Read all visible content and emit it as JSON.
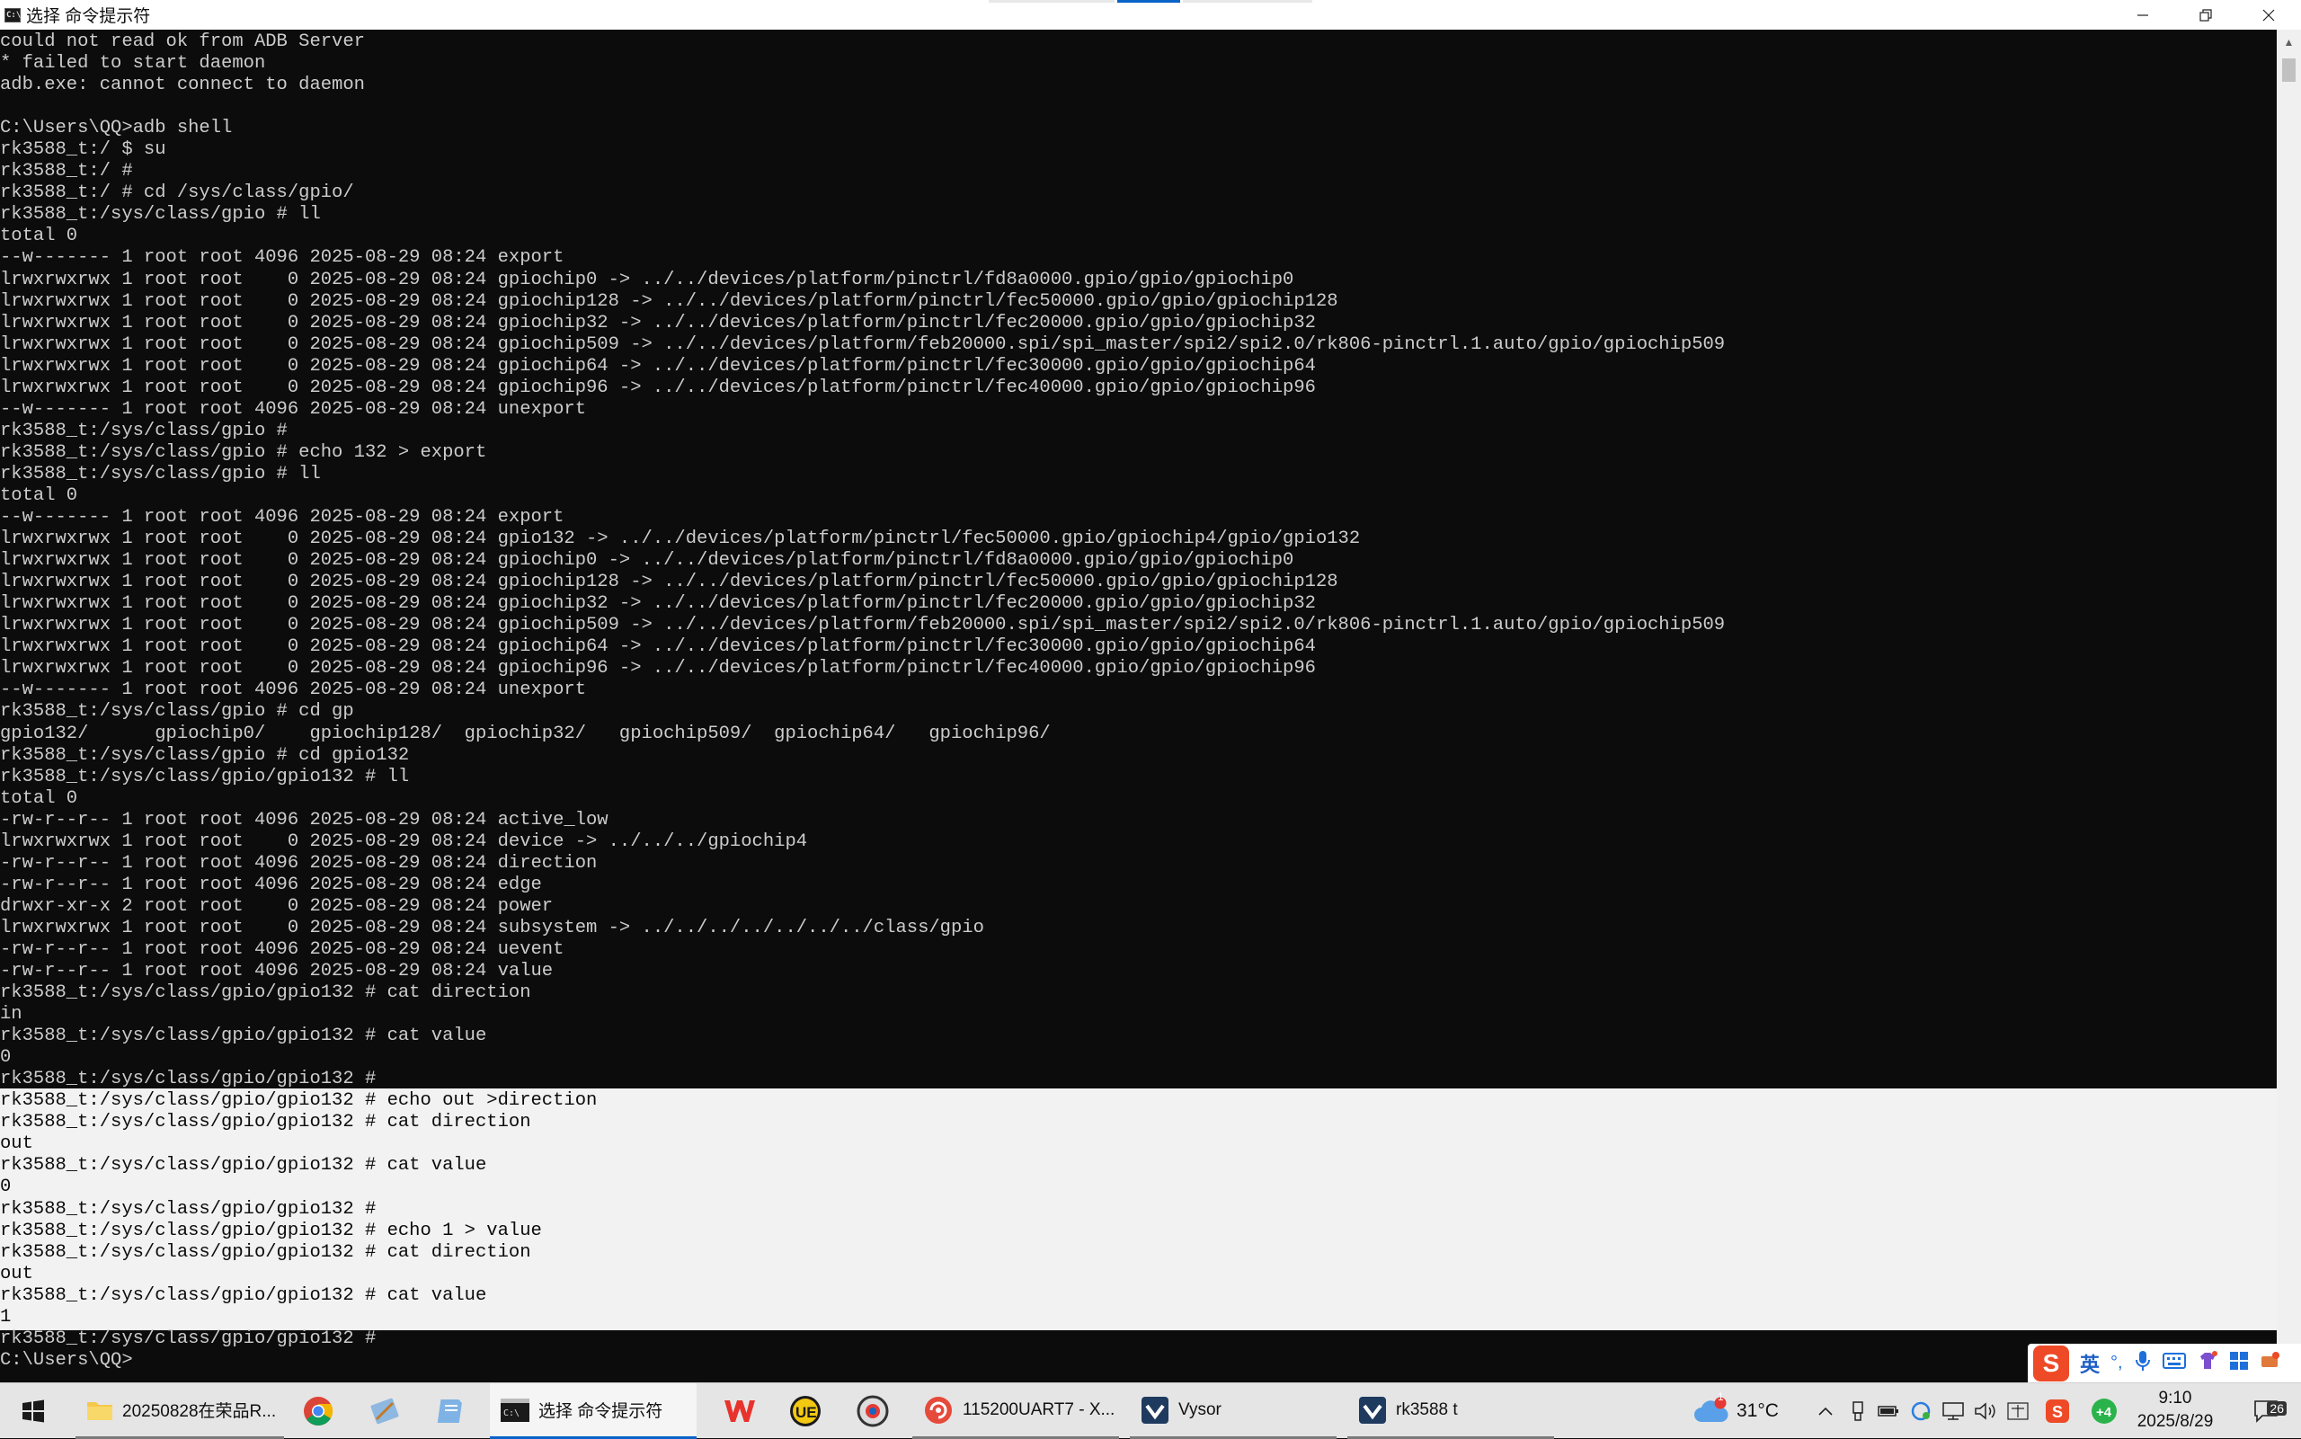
{
  "window": {
    "title": "选择 命令提示符",
    "icon_text": "C:\\"
  },
  "terminal": {
    "lines": [
      "could not read ok from ADB Server",
      "* failed to start daemon",
      "adb.exe: cannot connect to daemon",
      "",
      "C:\\Users\\QQ>adb shell",
      "rk3588_t:/ $ su",
      "rk3588_t:/ #",
      "rk3588_t:/ # cd /sys/class/gpio/",
      "rk3588_t:/sys/class/gpio # ll",
      "total 0",
      "--w------- 1 root root 4096 2025-08-29 08:24 export",
      "lrwxrwxrwx 1 root root    0 2025-08-29 08:24 gpiochip0 -> ../../devices/platform/pinctrl/fd8a0000.gpio/gpio/gpiochip0",
      "lrwxrwxrwx 1 root root    0 2025-08-29 08:24 gpiochip128 -> ../../devices/platform/pinctrl/fec50000.gpio/gpio/gpiochip128",
      "lrwxrwxrwx 1 root root    0 2025-08-29 08:24 gpiochip32 -> ../../devices/platform/pinctrl/fec20000.gpio/gpio/gpiochip32",
      "lrwxrwxrwx 1 root root    0 2025-08-29 08:24 gpiochip509 -> ../../devices/platform/feb20000.spi/spi_master/spi2/spi2.0/rk806-pinctrl.1.auto/gpio/gpiochip509",
      "lrwxrwxrwx 1 root root    0 2025-08-29 08:24 gpiochip64 -> ../../devices/platform/pinctrl/fec30000.gpio/gpio/gpiochip64",
      "lrwxrwxrwx 1 root root    0 2025-08-29 08:24 gpiochip96 -> ../../devices/platform/pinctrl/fec40000.gpio/gpio/gpiochip96",
      "--w------- 1 root root 4096 2025-08-29 08:24 unexport",
      "rk3588_t:/sys/class/gpio #",
      "rk3588_t:/sys/class/gpio # echo 132 > export",
      "rk3588_t:/sys/class/gpio # ll",
      "total 0",
      "--w------- 1 root root 4096 2025-08-29 08:24 export",
      "lrwxrwxrwx 1 root root    0 2025-08-29 08:24 gpio132 -> ../../devices/platform/pinctrl/fec50000.gpio/gpiochip4/gpio/gpio132",
      "lrwxrwxrwx 1 root root    0 2025-08-29 08:24 gpiochip0 -> ../../devices/platform/pinctrl/fd8a0000.gpio/gpio/gpiochip0",
      "lrwxrwxrwx 1 root root    0 2025-08-29 08:24 gpiochip128 -> ../../devices/platform/pinctrl/fec50000.gpio/gpio/gpiochip128",
      "lrwxrwxrwx 1 root root    0 2025-08-29 08:24 gpiochip32 -> ../../devices/platform/pinctrl/fec20000.gpio/gpio/gpiochip32",
      "lrwxrwxrwx 1 root root    0 2025-08-29 08:24 gpiochip509 -> ../../devices/platform/feb20000.spi/spi_master/spi2/spi2.0/rk806-pinctrl.1.auto/gpio/gpiochip509",
      "lrwxrwxrwx 1 root root    0 2025-08-29 08:24 gpiochip64 -> ../../devices/platform/pinctrl/fec30000.gpio/gpio/gpiochip64",
      "lrwxrwxrwx 1 root root    0 2025-08-29 08:24 gpiochip96 -> ../../devices/platform/pinctrl/fec40000.gpio/gpio/gpiochip96",
      "--w------- 1 root root 4096 2025-08-29 08:24 unexport",
      "rk3588_t:/sys/class/gpio # cd gp",
      "gpio132/      gpiochip0/    gpiochip128/  gpiochip32/   gpiochip509/  gpiochip64/   gpiochip96/",
      "rk3588_t:/sys/class/gpio # cd gpio132",
      "rk3588_t:/sys/class/gpio/gpio132 # ll",
      "total 0",
      "-rw-r--r-- 1 root root 4096 2025-08-29 08:24 active_low",
      "lrwxrwxrwx 1 root root    0 2025-08-29 08:24 device -> ../../../gpiochip4",
      "-rw-r--r-- 1 root root 4096 2025-08-29 08:24 direction",
      "-rw-r--r-- 1 root root 4096 2025-08-29 08:24 edge",
      "drwxr-xr-x 2 root root    0 2025-08-29 08:24 power",
      "lrwxrwxrwx 1 root root    0 2025-08-29 08:24 subsystem -> ../../../../../../../class/gpio",
      "-rw-r--r-- 1 root root 4096 2025-08-29 08:24 uevent",
      "-rw-r--r-- 1 root root 4096 2025-08-29 08:24 value",
      "rk3588_t:/sys/class/gpio/gpio132 # cat direction",
      "in",
      "rk3588_t:/sys/class/gpio/gpio132 # cat value",
      "0",
      "rk3588_t:/sys/class/gpio/gpio132 #",
      "rk3588_t:/sys/class/gpio/gpio132 # echo out >direction",
      "rk3588_t:/sys/class/gpio/gpio132 # cat direction",
      "out",
      "rk3588_t:/sys/class/gpio/gpio132 # cat value",
      "0",
      "rk3588_t:/sys/class/gpio/gpio132 #",
      "rk3588_t:/sys/class/gpio/gpio132 # echo 1 > value",
      "rk3588_t:/sys/class/gpio/gpio132 # cat direction",
      "out",
      "rk3588_t:/sys/class/gpio/gpio132 # cat value",
      "1",
      "rk3588_t:/sys/class/gpio/gpio132 #",
      "C:\\Users\\QQ>"
    ],
    "selected_from": 49,
    "selected_to": 59
  },
  "ime": {
    "logo": "S",
    "lang": "英",
    "punct": "°,",
    "icons": [
      "mic-icon",
      "keyboard-icon",
      "skin-icon",
      "toolbox-icon",
      "more-icon"
    ]
  },
  "taskbar": {
    "items": [
      {
        "name": "start-button",
        "label": "",
        "icon": "windows-icon"
      },
      {
        "name": "taskbar-explorer",
        "label": "20250828在荣品R...",
        "icon": "folder-icon"
      },
      {
        "name": "taskbar-chrome",
        "label": "",
        "icon": "chrome-icon"
      },
      {
        "name": "taskbar-tool",
        "label": "",
        "icon": "tool-icon"
      },
      {
        "name": "taskbar-notepad",
        "label": "",
        "icon": "notepad-icon"
      },
      {
        "name": "taskbar-cmd",
        "label": "选择 命令提示符",
        "icon": "cmd-icon"
      },
      {
        "name": "taskbar-wps",
        "label": "",
        "icon": "wps-icon"
      },
      {
        "name": "taskbar-ultraedit",
        "label": "",
        "icon": "ue-icon"
      },
      {
        "name": "taskbar-browser",
        "label": "",
        "icon": "browser-icon"
      },
      {
        "name": "taskbar-serial",
        "label": "115200UART7 - X...",
        "icon": "serial-icon"
      },
      {
        "name": "taskbar-vysor",
        "label": "Vysor",
        "icon": "vysor-icon"
      },
      {
        "name": "taskbar-rk3588",
        "label": "rk3588 t",
        "icon": "vysor-icon"
      }
    ],
    "weather": {
      "temp": "31°C",
      "badge": "1"
    },
    "clock": {
      "time": "9:10",
      "date": "2025/8/29"
    },
    "notifications": "26"
  },
  "colors": {
    "terminal_bg": "#0c0c0c",
    "terminal_fg": "#cccccc",
    "selection_bg": "#f2f2f2",
    "taskbar_bg": "#e5e5e5",
    "accent": "#0a64c8"
  }
}
